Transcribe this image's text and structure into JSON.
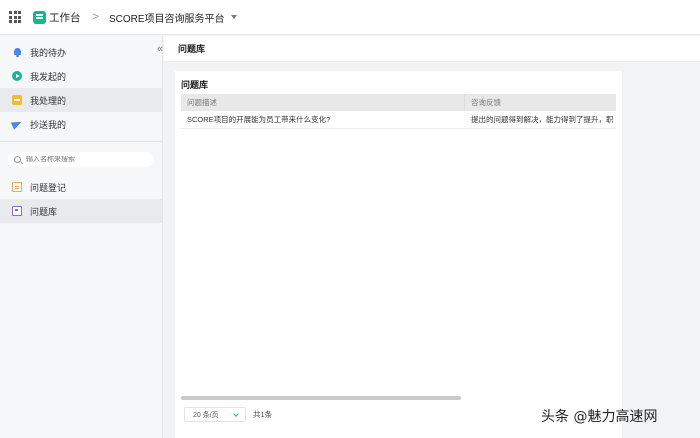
{
  "topbar": {
    "app_title": "工作台",
    "separator": ">",
    "platform_name": "SCORE项目咨询服务平台"
  },
  "sidebar": {
    "collapse_glyph": "«",
    "items": [
      {
        "label": "我的待办",
        "icon": "bell-icon"
      },
      {
        "label": "我发起的",
        "icon": "play-circle-icon"
      },
      {
        "label": "我处理的",
        "icon": "inbox-icon"
      },
      {
        "label": "抄送我的",
        "icon": "send-icon"
      }
    ],
    "search": {
      "placeholder": "输入名称来搜索"
    },
    "apps": [
      {
        "label": "问题登记",
        "icon": "document-icon"
      },
      {
        "label": "问题库",
        "icon": "board-icon"
      }
    ]
  },
  "main": {
    "header_title": "问题库",
    "panel_title": "问题库",
    "table": {
      "columns": [
        "问题描述",
        "咨询反馈"
      ],
      "rows": [
        [
          "SCORE项目的开展能为员工带来什么变化?",
          "提出的问题得到解决，能力得到了提升，职"
        ]
      ]
    },
    "pagination": {
      "page_size": "20 条/页",
      "total": "共1条"
    }
  },
  "watermark": "头条 @魅力高速网",
  "colors": {
    "accent": "#1ab394",
    "active_bg": "#e8eaee"
  }
}
